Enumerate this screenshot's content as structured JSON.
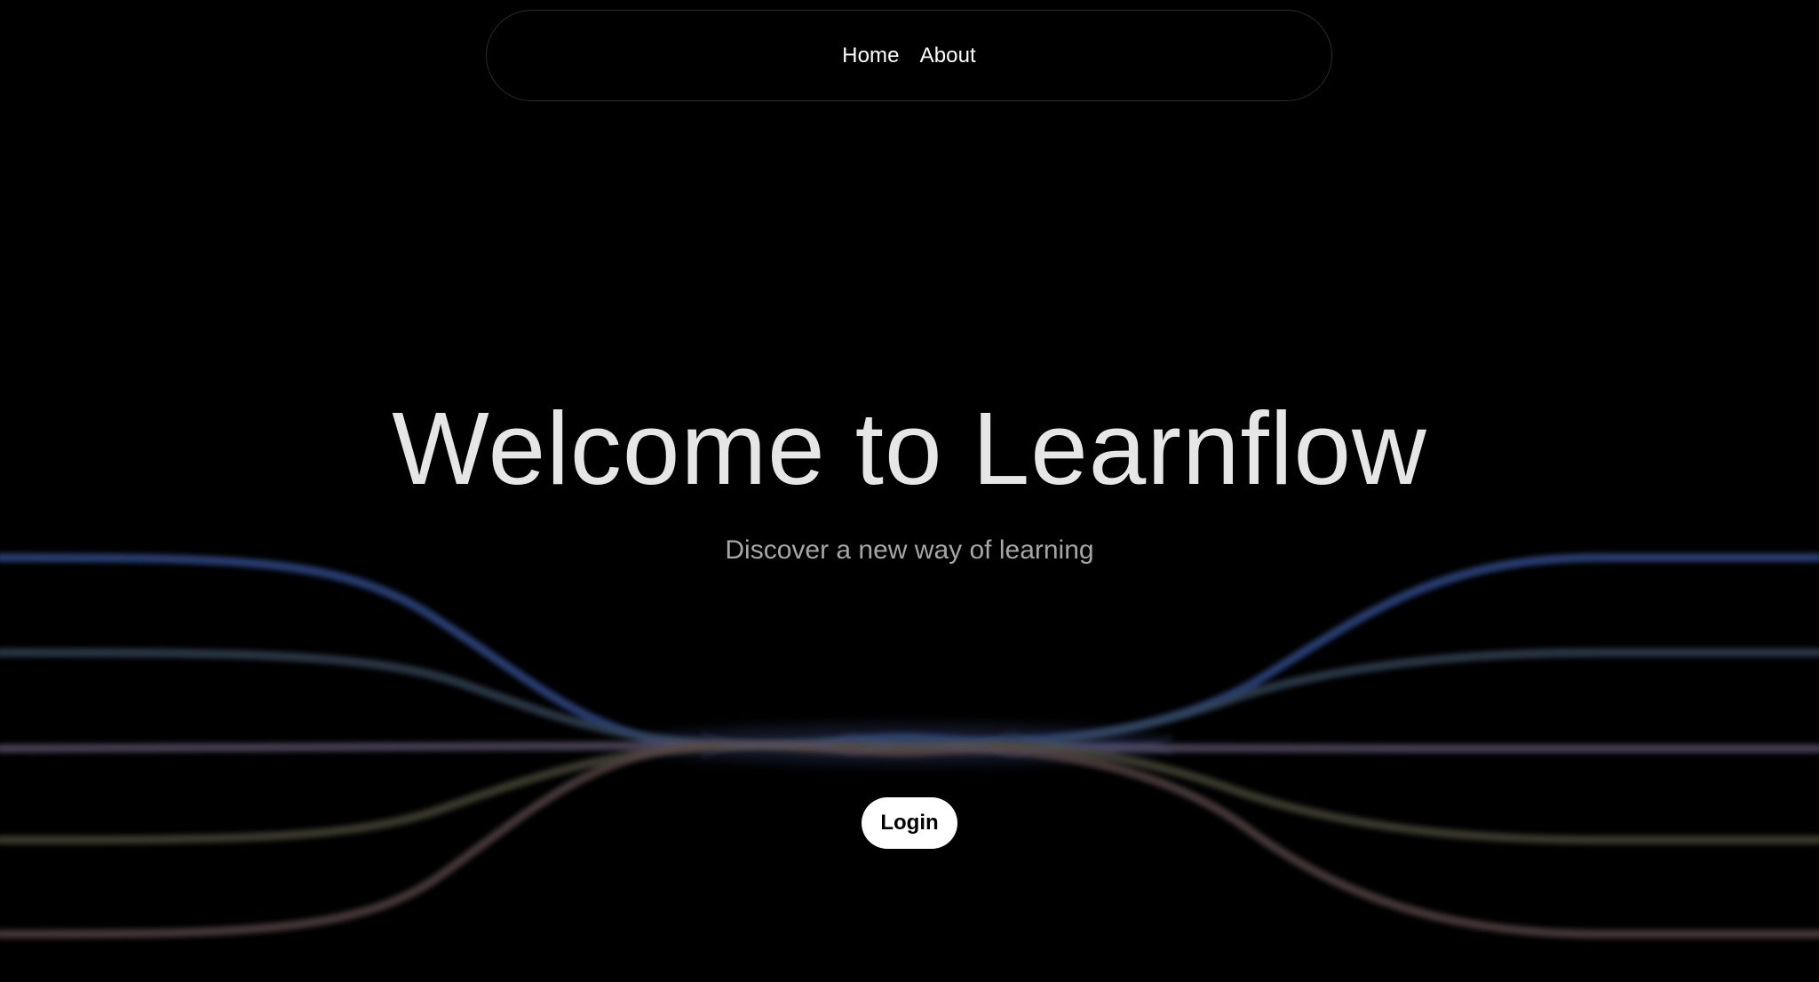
{
  "nav": {
    "links": [
      {
        "label": "Home"
      },
      {
        "label": "About"
      }
    ]
  },
  "hero": {
    "title": "Welcome to Learnflow",
    "subtitle": "Discover a new way of learning",
    "login_label": "Login"
  },
  "colors": {
    "background": "#000000",
    "title": "#e6e6e6",
    "subtitle": "#a6a6a6",
    "button_bg": "#ffffff",
    "button_text": "#000000",
    "wave_blue": "#2e4a8a",
    "wave_slate": "#34465a",
    "wave_mauve": "#5a5068",
    "wave_olive": "#4a4a3a",
    "wave_rose": "#5a4848"
  }
}
